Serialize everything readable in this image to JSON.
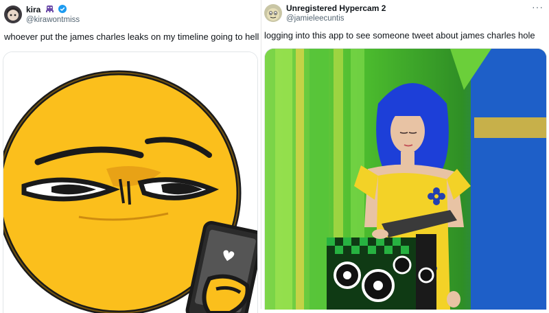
{
  "left_tweet": {
    "display_name": "kira",
    "handle": "@kirawontmiss",
    "text": "whoever put the james charles leaks on my timeline going to hell",
    "avatar_icon": "anime-avatar-icon",
    "badge_icon": "alien-monster-emoji-icon",
    "verified_icon": "verified-badge-icon",
    "verified_color": "#1d9bf0",
    "media_icon": "yellow-emoji-face-holding-phone-image"
  },
  "right_tweet": {
    "display_name": "Unregistered Hypercam 2",
    "handle": "@jamieleecuntis",
    "text": "logging into this app to see someone tweet about james charles hole",
    "avatar_icon": "meme-face-avatar-icon",
    "more_icon": "more-dots-icon",
    "more_label": "···",
    "media_icon": "stage-performer-blue-wig-image"
  },
  "colors": {
    "text_primary": "#0f1419",
    "text_secondary": "#536471",
    "emoji_yellow": "#fbbf1c",
    "stage_green": "#5cc23a",
    "wig_blue": "#1d3fd8"
  }
}
